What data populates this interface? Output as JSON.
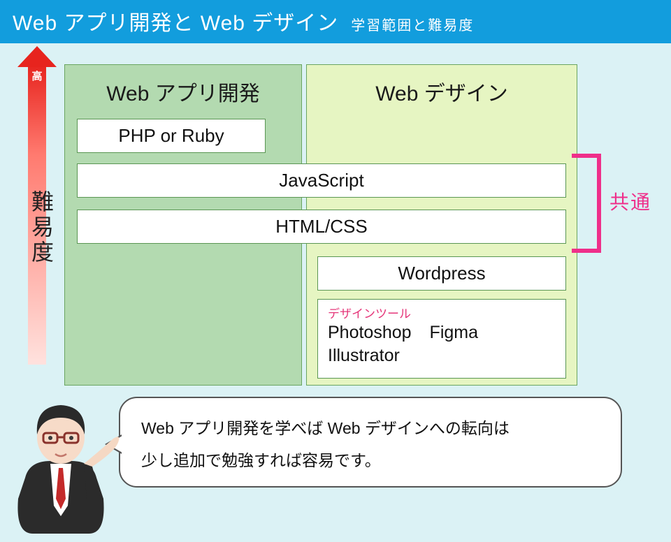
{
  "header": {
    "title": "Web アプリ開発と Web デザイン",
    "subtitle": "学習範囲と難易度"
  },
  "axis": {
    "top": "高",
    "label": "難易度"
  },
  "panels": {
    "dev": "Web アプリ開発",
    "design": "Web デザイン"
  },
  "skills": {
    "php": "PHP or Ruby",
    "js": "JavaScript",
    "css": "HTML/CSS",
    "wp": "Wordpress"
  },
  "toolbox": {
    "caption": "デザインツール",
    "items": [
      "Photoshop",
      "Figma",
      "Illustrator"
    ]
  },
  "bracket_label": "共通",
  "bubble": {
    "line1": "Web アプリ開発を学べば Web デザインへの転向は",
    "line2": "少し追加で勉強すれば容易です。"
  },
  "colors": {
    "header_bg": "#129ddd",
    "page_bg": "#dbf2f5",
    "dev_bg": "#b3dab0",
    "design_bg": "#e6f5c2",
    "accent_pink": "#ef2f8a",
    "arrow_red": "#e7241e"
  }
}
